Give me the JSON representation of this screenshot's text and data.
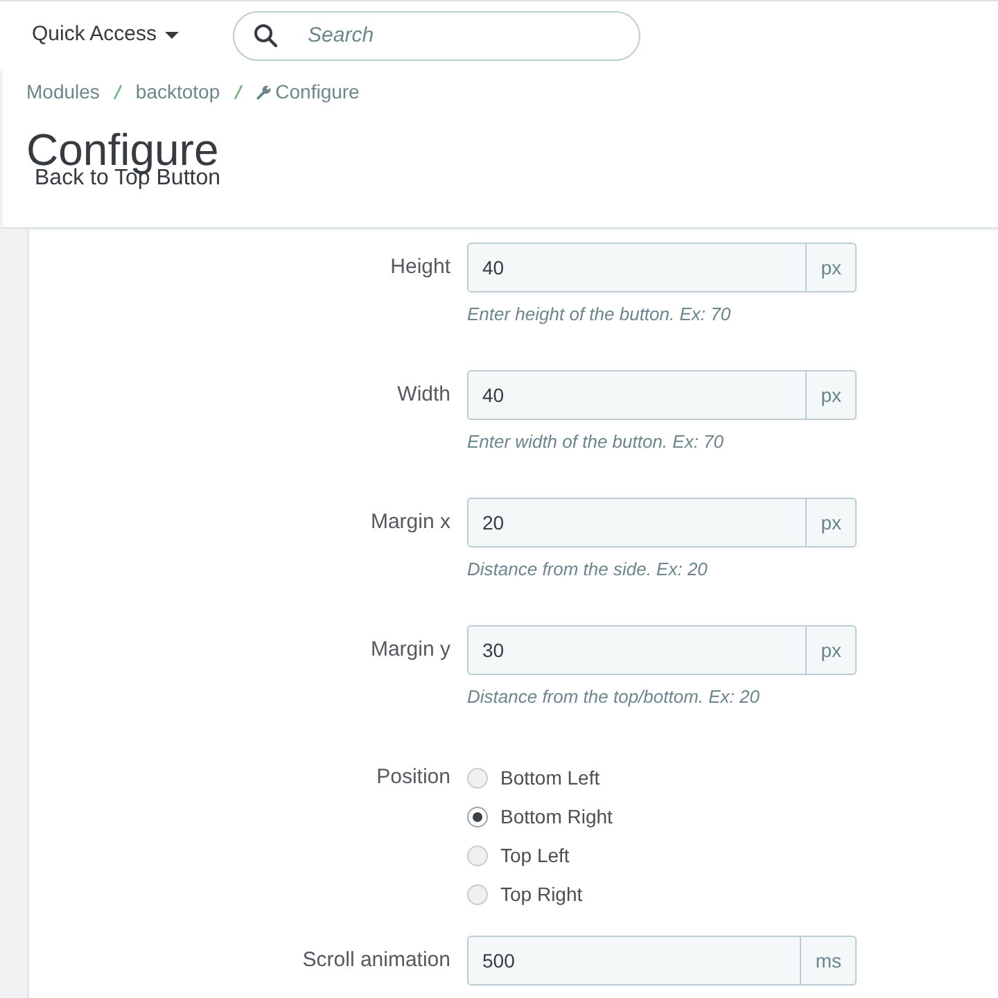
{
  "top_bar": {
    "quick_access": {
      "label": "Quick Access"
    },
    "search": {
      "placeholder": "Search"
    }
  },
  "breadcrumb": [
    {
      "kind": "link",
      "label": "Modules"
    },
    {
      "kind": "link",
      "label": "backtotop"
    },
    {
      "kind": "current",
      "label": "Configure"
    }
  ],
  "page_header": {
    "title": "Configure",
    "subtitle": "Back to Top Button"
  },
  "form": {
    "fields": [
      {
        "kind": "input",
        "label": "Height",
        "value": "40",
        "addon": "px",
        "help": "Enter height of the button. Ex: 70"
      },
      {
        "kind": "input",
        "label": "Width",
        "value": "40",
        "addon": "px",
        "help": "Enter width of the button. Ex: 70"
      },
      {
        "kind": "input",
        "label": "Margin x",
        "value": "20",
        "addon": "px",
        "help": "Distance from the side. Ex: 20"
      },
      {
        "kind": "input",
        "label": "Margin y",
        "value": "30",
        "addon": "px",
        "help": "Distance from the top/bottom. Ex: 20"
      },
      {
        "kind": "radio",
        "label": "Position",
        "options": [
          {
            "label": "Bottom Left",
            "selected": false
          },
          {
            "label": "Bottom Right",
            "selected": true
          },
          {
            "label": "Top Left",
            "selected": false
          },
          {
            "label": "Top Right",
            "selected": false
          }
        ]
      },
      {
        "kind": "input",
        "label": "Scroll animation",
        "value": "500",
        "addon": "ms"
      }
    ]
  }
}
